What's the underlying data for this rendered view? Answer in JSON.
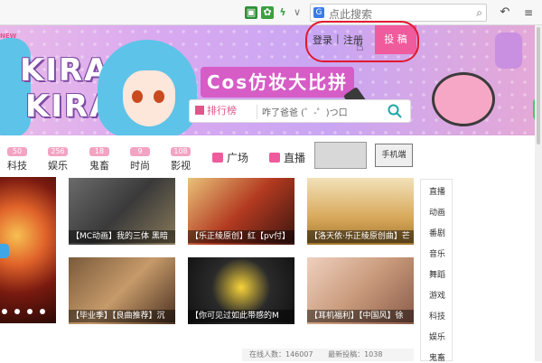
{
  "browser": {
    "search_placeholder": "点此搜索",
    "search_engine_logo": "G"
  },
  "banner": {
    "new_tag": "NEW",
    "logo_line1": "KIRA",
    "logo_line2": "KIRA",
    "event_title": "Cos仿妆大比拼"
  },
  "header": {
    "login_label": "登录",
    "separator": "|",
    "register_label": "注册",
    "upload_label": "投 稿"
  },
  "search": {
    "rank_label": "排行榜",
    "placeholder": "咋了爸爸 (゜-゜)つ口"
  },
  "categories": [
    {
      "badge": "50",
      "label": "科技"
    },
    {
      "badge": "256",
      "label": "娱乐"
    },
    {
      "badge": "18",
      "label": "鬼畜"
    },
    {
      "badge": "9",
      "label": "时尚"
    },
    {
      "badge": "108",
      "label": "影视"
    }
  ],
  "nav_links": {
    "square": "广场",
    "live": "直播",
    "mobile_badge": "手机端"
  },
  "videos": [
    {
      "title": "【MC动画】我的三体 黑暗"
    },
    {
      "title": "【乐正绫原创】红【pv付】"
    },
    {
      "title": "【洛天依·乐正绫原创曲】芒"
    },
    {
      "title": "【毕业季】【良曲推荐】沉"
    },
    {
      "title": "【你可见过如此带感的M"
    },
    {
      "title": "【耳机福利】【中国风】徐"
    }
  ],
  "side_menu": [
    "直播",
    "动画",
    "番剧",
    "音乐",
    "舞蹈",
    "游戏",
    "科技",
    "娱乐",
    "鬼畜"
  ],
  "footer": {
    "online_text": "在线人数：146007",
    "latest_text": "最新投稿：1038"
  },
  "colors": {
    "accent": "#ef5b9c",
    "highlight_circle": "#e0192f"
  }
}
